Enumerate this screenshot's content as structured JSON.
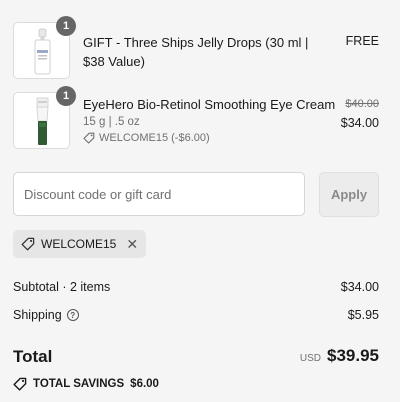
{
  "items": [
    {
      "quantity": "1",
      "title": "GIFT - Three Ships Jelly Drops (30 ml | $38 Value)",
      "price": "FREE",
      "image_icon": "dropper-bottle-icon"
    },
    {
      "quantity": "1",
      "title": "EyeHero Bio-Retinol Smoothing Eye Cream",
      "variant": "15 g | .5 oz",
      "discount": "WELCOME15 (-$6.00)",
      "price_original": "$40.00",
      "price": "$34.00",
      "image_icon": "tube-icon"
    }
  ],
  "discount_field": {
    "placeholder": "Discount code or gift card",
    "button_label": "Apply"
  },
  "applied_code": {
    "label": "WELCOME15",
    "remove": "✕"
  },
  "summary": {
    "subtotal_label": "Subtotal · 2 items",
    "subtotal_value": "$34.00",
    "shipping_label": "Shipping",
    "shipping_info": "?",
    "shipping_value": "$5.95",
    "total_label": "Total",
    "currency": "USD",
    "total_value": "$39.95",
    "savings_label": "TOTAL SAVINGS",
    "savings_value": "$6.00"
  },
  "colors": {
    "background": "#f5f5f5",
    "badge": "#666666",
    "text": "#1a1a1a",
    "muted": "#707070"
  }
}
